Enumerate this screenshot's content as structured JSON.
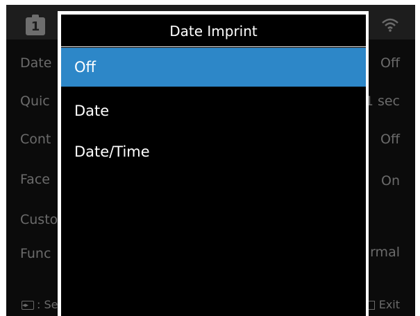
{
  "background_menu": {
    "rows": [
      {
        "label": "Date",
        "value": "Off"
      },
      {
        "label": "Quic",
        "value": "1 sec"
      },
      {
        "label": "Cont",
        "value": "Off"
      },
      {
        "label": "Face",
        "value": "On"
      },
      {
        "label": "Custo",
        "value": ""
      },
      {
        "label": "Func",
        "value": "rmal"
      }
    ],
    "top_left_icon": "1",
    "top_right_icon": "wifi-icon",
    "bottom_left_text": ": Se",
    "bottom_right_text": "Exit"
  },
  "dialog": {
    "title": "Date Imprint",
    "options": [
      {
        "label": "Off",
        "selected": true
      },
      {
        "label": "Date",
        "selected": false
      },
      {
        "label": "Date/Time",
        "selected": false
      }
    ]
  },
  "colors": {
    "selection": "#2d87c8",
    "screen_background": "#0b0b0b",
    "dimmed_text": "#6b6b6b",
    "dialog_border": "#ffffff"
  }
}
